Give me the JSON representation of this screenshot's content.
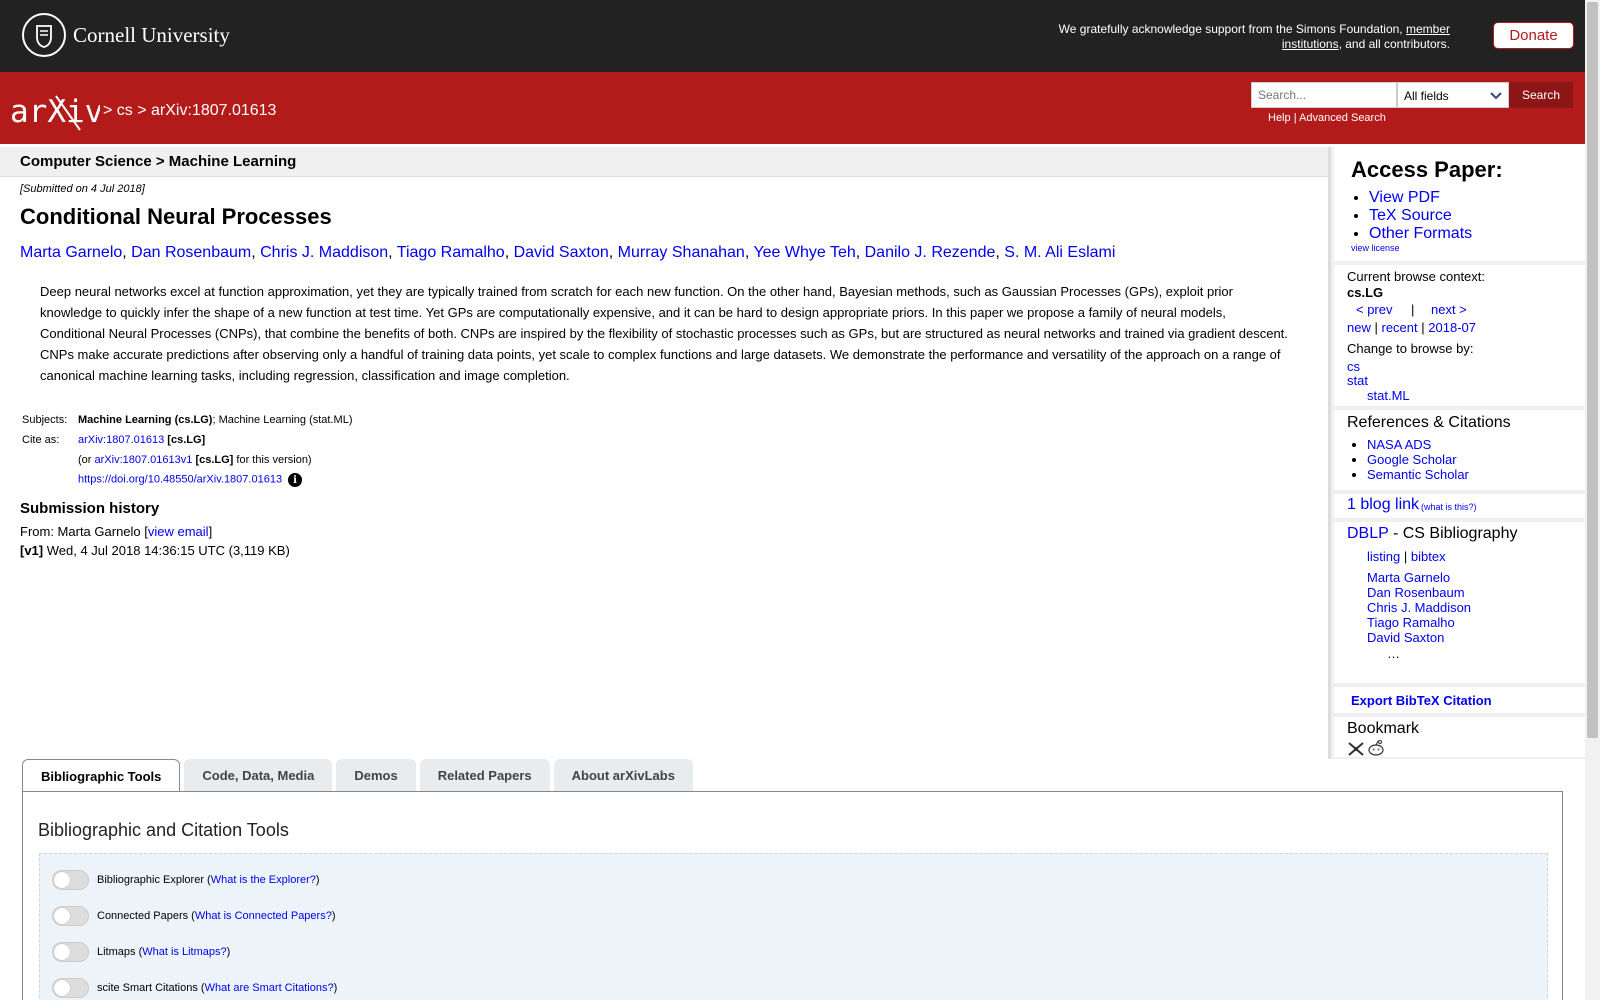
{
  "cornell": {
    "name": "Cornell University",
    "support_text": "We gratefully acknowledge support from the Simons Foundation,",
    "support_link": "member institutions",
    "support_tail": ", and all contributors.",
    "donate": "Donate"
  },
  "header": {
    "logo": "arXiv",
    "breadcrumb": "> cs > arXiv:1807.01613",
    "search_placeholder": "Search...",
    "search_field": "All fields",
    "search_button": "Search",
    "help": "Help",
    "sep": "|",
    "advanced": "Advanced Search"
  },
  "subject_bar": "Computer Science > Machine Learning",
  "submitted": "[Submitted on 4 Jul 2018]",
  "title": "Conditional Neural Processes",
  "authors": [
    "Marta Garnelo",
    "Dan Rosenbaum",
    "Chris J. Maddison",
    "Tiago Ramalho",
    "David Saxton",
    "Murray Shanahan",
    "Yee Whye Teh",
    "Danilo J. Rezende",
    "S. M. Ali Eslami"
  ],
  "abstract": "Deep neural networks excel at function approximation, yet they are typically trained from scratch for each new function. On the other hand, Bayesian methods, such as Gaussian Processes (GPs), exploit prior knowledge to quickly infer the shape of a new function at test time. Yet GPs are computationally expensive, and it can be hard to design appropriate priors. In this paper we propose a family of neural models, Conditional Neural Processes (CNPs), that combine the benefits of both. CNPs are inspired by the flexibility of stochastic processes such as GPs, but are structured as neural networks and trained via gradient descent. CNPs make accurate predictions after observing only a handful of training data points, yet scale to complex functions and large datasets. We demonstrate the performance and versatility of the approach on a range of canonical machine learning tasks, including regression, classification and image completion.",
  "meta": {
    "subjects_label": "Subjects:",
    "subjects_primary": "Machine Learning (cs.LG)",
    "subjects_rest": "; Machine Learning (stat.ML)",
    "cite_label": "Cite as:",
    "cite_id": "arXiv:1807.01613",
    "cite_cat": "[cs.LG]",
    "or_prefix": "(or",
    "version_id": "arXiv:1807.01613v1",
    "version_cat": "[cs.LG]",
    "version_tail": "for this version)",
    "doi": "https://doi.org/10.48550/arXiv.1807.01613"
  },
  "history": {
    "title": "Submission history",
    "from_label": "From: Marta Garnelo [",
    "view_email": "view email",
    "from_close": "]",
    "v1_label": "[v1]",
    "v1_text": "Wed, 4 Jul 2018 14:36:15 UTC (3,119 KB)"
  },
  "sidebar": {
    "access_title": "Access Paper:",
    "access_links": [
      "View PDF",
      "TeX Source",
      "Other Formats"
    ],
    "view_license": "view license",
    "context_label": "Current browse context:",
    "context_value": "cs.LG",
    "prev": "< prev",
    "pipe": "|",
    "next": "next >",
    "new": "new",
    "recent": "recent",
    "month": "2018-07",
    "change_label": "Change to browse by:",
    "browse_cs": "cs",
    "browse_stat": "stat",
    "browse_statml": "stat.ML",
    "refs_title": "References & Citations",
    "refs_links": [
      "NASA ADS",
      "Google Scholar",
      "Semantic Scholar"
    ],
    "blog_link": "1 blog link",
    "blog_what": "(what is this?)",
    "dblp": "DBLP",
    "dblp_rest": " - CS Bibliography",
    "listing": "listing",
    "bibtex": "bibtex",
    "dblp_authors": [
      "Marta Garnelo",
      "Dan Rosenbaum",
      "Chris J. Maddison",
      "Tiago Ramalho",
      "David Saxton"
    ],
    "ellipsis": "…",
    "export": "Export BibTeX Citation",
    "bookmark": "Bookmark"
  },
  "tabs": [
    "Bibliographic Tools",
    "Code, Data, Media",
    "Demos",
    "Related Papers",
    "About arXivLabs"
  ],
  "tools": {
    "title": "Bibliographic and Citation Tools",
    "rows": [
      {
        "label": "Bibliographic Explorer",
        "link": "What is the Explorer?"
      },
      {
        "label": "Connected Papers",
        "link": "What is Connected Papers?"
      },
      {
        "label": "Litmaps",
        "link": "What is Litmaps?"
      },
      {
        "label": "scite Smart Citations",
        "link": "What are Smart Citations?"
      }
    ]
  }
}
